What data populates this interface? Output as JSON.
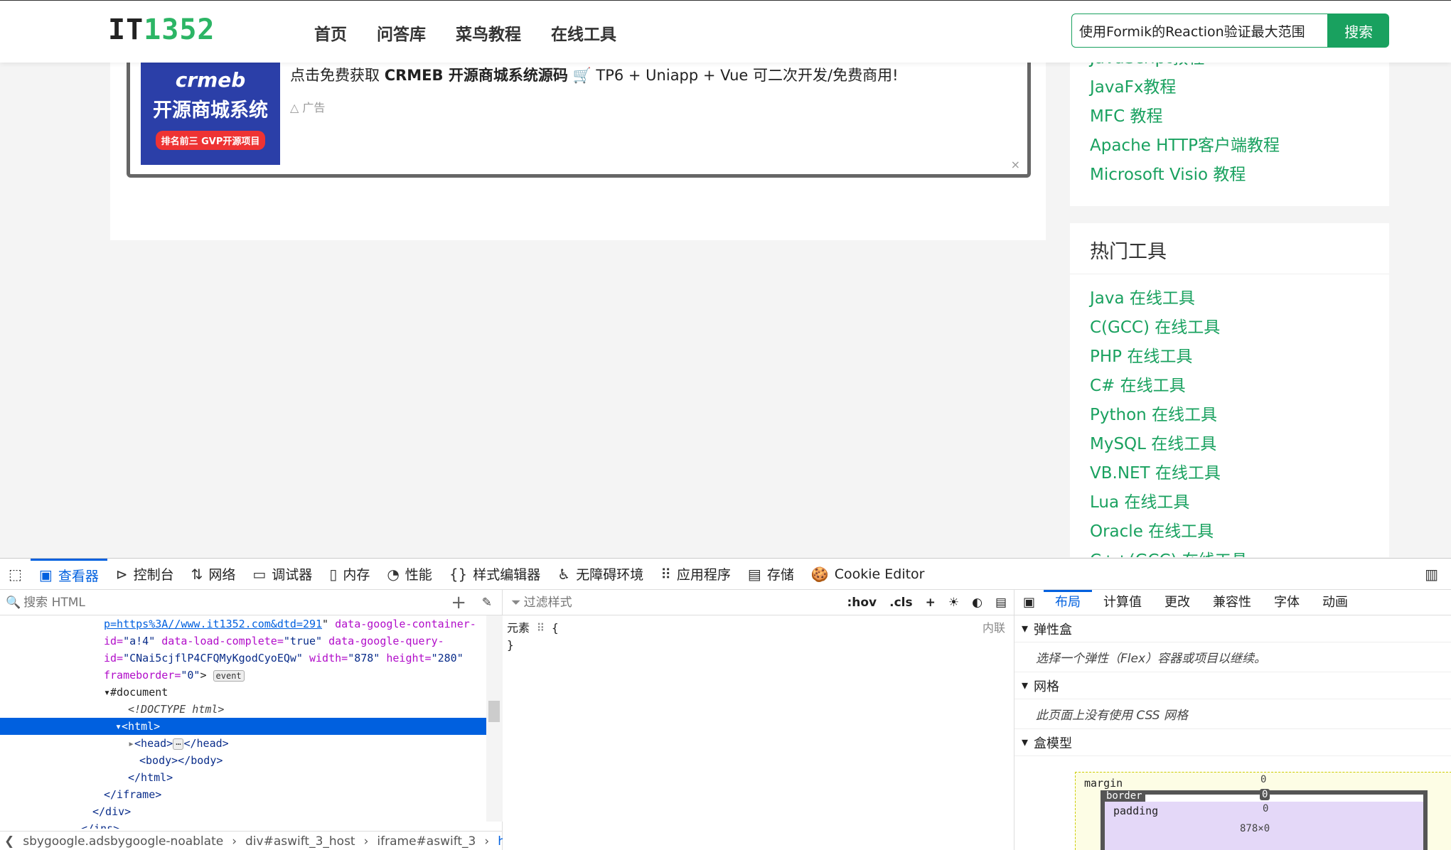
{
  "site": {
    "logo_prefix": "IT",
    "logo_number": "1352",
    "nav": [
      "首页",
      "问答库",
      "菜鸟教程",
      "在线工具"
    ],
    "search_value": "使用Formik的Reaction验证最大范围",
    "search_button": "搜索"
  },
  "ad": {
    "image_line1": "crmeb",
    "image_line2": "开源商城系统",
    "image_line3": "排名前三 GVP开源项目",
    "text_prefix": "点击免费获取",
    "text_bold": "CRMEB 开源商城系统源码",
    "text_suffix": "TP6 + Uniapp + Vue 可二次开发/免费商用!",
    "label": "广告",
    "close": "×"
  },
  "sidebar_top": {
    "links": [
      "JavaScript教程",
      "JavaFx教程",
      "MFC 教程",
      "Apache HTTP客户端教程",
      "Microsoft Visio 教程"
    ]
  },
  "sidebar_tools": {
    "title": "热门工具",
    "links": [
      "Java 在线工具",
      "C(GCC) 在线工具",
      "PHP 在线工具",
      "C# 在线工具",
      "Python 在线工具",
      "MySQL 在线工具",
      "VB.NET 在线工具",
      "Lua 在线工具",
      "Oracle 在线工具",
      "C++(GCC) 在线工具"
    ]
  },
  "devtools": {
    "tabs": [
      "查看器",
      "控制台",
      "网络",
      "调试器",
      "内存",
      "性能",
      "样式编辑器",
      "无障碍环境",
      "应用程序",
      "存储",
      "Cookie Editor"
    ],
    "search_placeholder": "搜索 HTML",
    "code": {
      "l1_link": "p=https%3A//www.it1352.com&dtd=291",
      "l1_attr": "data-google-container-",
      "l2_a": "id=",
      "l2_v": "\"a!4\"",
      "l2_b": "data-load-complete=",
      "l2_c": "\"true\"",
      "l2_d": "data-google-query-",
      "l3_a": "id=",
      "l3_v": "\"CNai5cjflP4CFQMyKgodCyoEQw\"",
      "l3_b": "width=",
      "l3_bv": "\"878\"",
      "l3_c": "height=",
      "l3_cv": "\"280\"",
      "l4_a": "frameborder=",
      "l4_v": "\"0\"",
      "l4_badge": "event",
      "l5": "#document",
      "l6": "<!DOCTYPE html>",
      "l7": "<html>",
      "l8_open": "<head>",
      "l8_close": "</head>",
      "l9": "<body></body>",
      "l10": "</html>",
      "l11": "</iframe>",
      "l12": "</div>",
      "l13": "</ins>"
    },
    "breadcrumbs": [
      "sbygoogle.adsbygoogle-noablate",
      "div#aswift_3_host",
      "iframe#aswift_3",
      "html"
    ],
    "filter_placeholder": "过滤样式",
    "filter_tools": [
      ":hov",
      ".cls"
    ],
    "rule_selector": "元素",
    "rule_open": "{",
    "rule_close": "}",
    "rule_source": "内联",
    "layout_tabs": [
      "布局",
      "计算值",
      "更改",
      "兼容性",
      "字体",
      "动画"
    ],
    "flex_head": "弹性盒",
    "flex_body": "选择一个弹性（Flex）容器或项目以继续。",
    "grid_head": "网格",
    "grid_body": "此页面上没有使用 CSS 网格",
    "boxmodel_head": "盒模型",
    "bm_margin": "margin",
    "bm_border": "border",
    "bm_padding": "padding",
    "bm_zero": "0",
    "bm_size": "878×0"
  }
}
